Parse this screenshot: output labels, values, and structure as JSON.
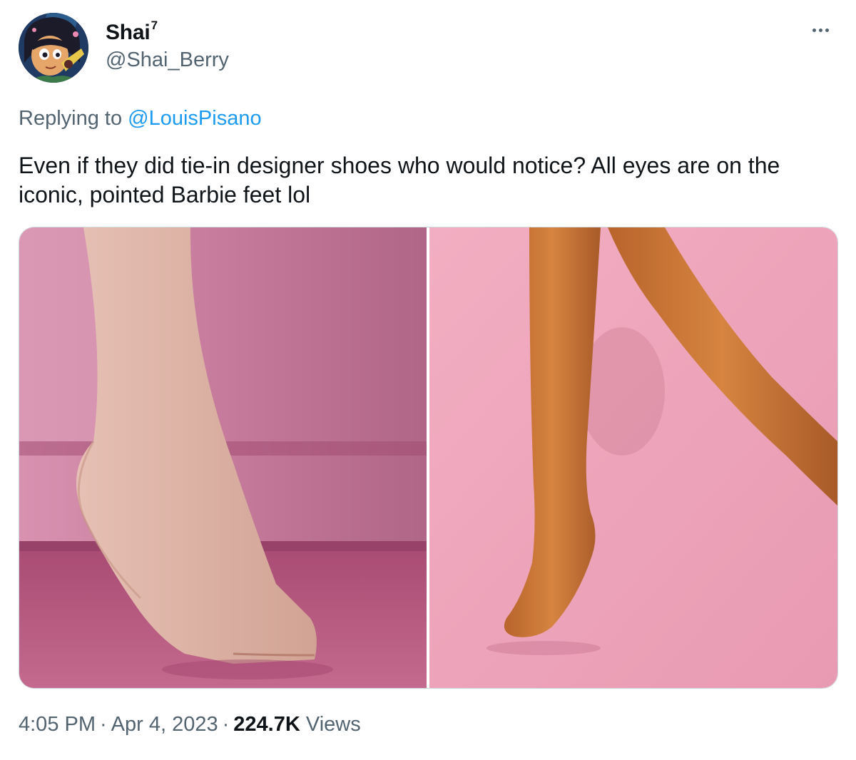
{
  "author": {
    "display_name": "Shai",
    "name_suffix": "7",
    "handle": "@Shai_Berry",
    "avatar_icon": "cartoon-girl-avatar"
  },
  "more_icon": "more-horizontal-icon",
  "reply": {
    "prefix": "Replying to",
    "to_handle": "@LouisPisano"
  },
  "tweet": {
    "text": "Even if they did tie-in designer shoes who would notice? All eyes are on the iconic, pointed Barbie feet lol"
  },
  "media": {
    "left_image": "photo-human-foot-on-tiptoe-pink-background",
    "right_image": "photo-barbie-doll-legs-pink-background"
  },
  "meta": {
    "time": "4:05 PM",
    "date": "Apr 4, 2023",
    "views_count": "224.7K",
    "views_label": "Views",
    "separator": "·"
  },
  "colors": {
    "link": "#1d9bf0",
    "secondary_text": "#536471",
    "primary_text": "#0f1419"
  }
}
